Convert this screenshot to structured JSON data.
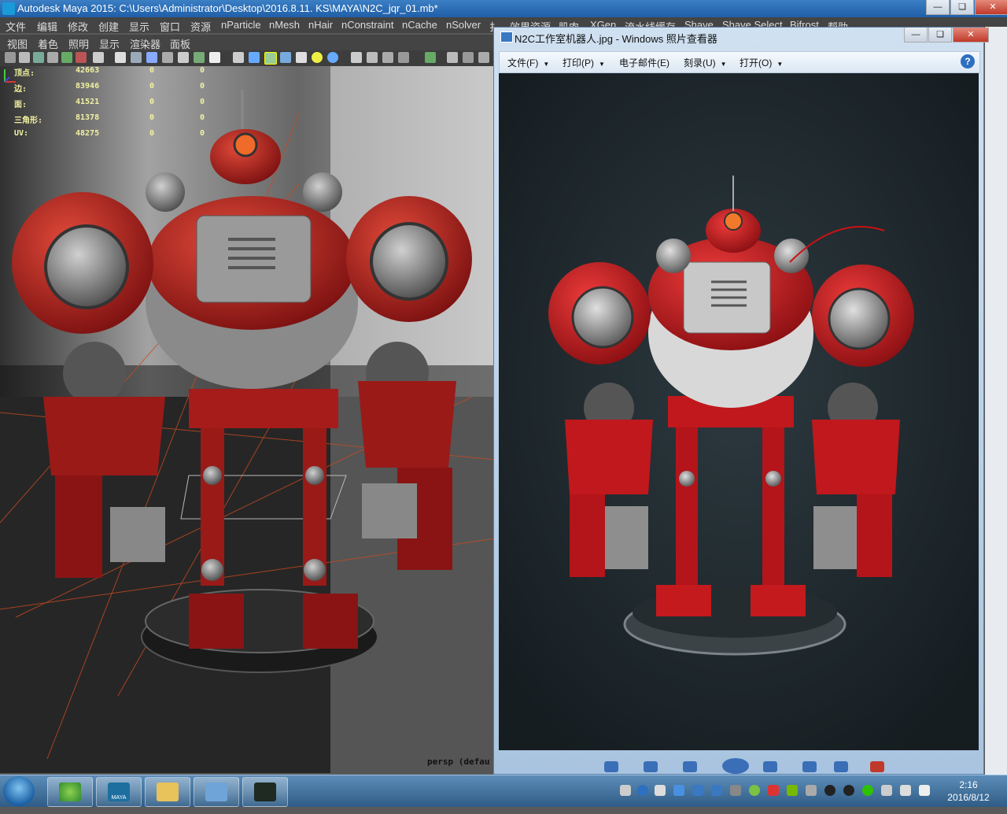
{
  "maya": {
    "title": "Autodesk Maya 2015: C:\\Users\\Administrator\\Desktop\\2016.8.11. KS\\MAYA\\N2C_jqr_01.mb*",
    "menu": [
      "文件",
      "编辑",
      "修改",
      "创建",
      "显示",
      "窗口",
      "资源",
      "nParticle",
      "nMesh",
      "nHair",
      "nConstraint",
      "nCache",
      "nSolver",
      "扌",
      "效果资源",
      "肌肉",
      "XGen",
      "流水线缓存",
      "Shave",
      "Shave Select",
      "Bifrost",
      "帮助"
    ],
    "panel_menu": [
      "视图",
      "着色",
      "照明",
      "显示",
      "渲染器",
      "面板"
    ],
    "hud": [
      {
        "label": "顶点:",
        "values": [
          "42663",
          "0",
          "0"
        ]
      },
      {
        "label": "边:",
        "values": [
          "83946",
          "0",
          "0"
        ]
      },
      {
        "label": "面:",
        "values": [
          "41521",
          "0",
          "0"
        ]
      },
      {
        "label": "三角形:",
        "values": [
          "81378",
          "0",
          "0"
        ]
      },
      {
        "label": "UV:",
        "values": [
          "48275",
          "0",
          "0"
        ]
      }
    ],
    "camera_label": "persp (defau",
    "colors": {
      "accent": "#c81e1e",
      "hud": "#f2f2a0"
    }
  },
  "viewer": {
    "title": "N2C工作室机器人.jpg - Windows 照片查看器",
    "menu": [
      "文件(F)",
      "打印(P)",
      "电子邮件(E)",
      "刻录(U)",
      "打开(O)"
    ],
    "help_icon": "?"
  },
  "taskbar": {
    "apps": [
      "ie-icon",
      "maya-icon",
      "explorer-icon",
      "photo-viewer-icon",
      "terminal-icon"
    ],
    "maya_badge": "MAYA",
    "time": "2:16",
    "date": "2016/8/12"
  }
}
